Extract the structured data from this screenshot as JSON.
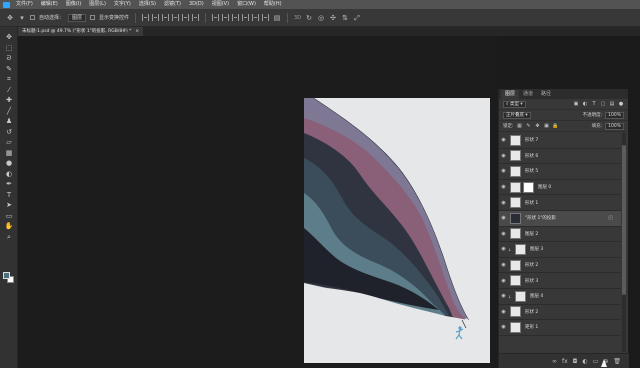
{
  "menubar": {
    "items": [
      "文件(F)",
      "编辑(E)",
      "图像(I)",
      "图层(L)",
      "文字(Y)",
      "选择(S)",
      "滤镜(T)",
      "3D(D)",
      "视图(V)",
      "窗口(W)",
      "帮助(H)"
    ]
  },
  "optionsbar": {
    "auto_select_label": "自动选择：",
    "auto_select_value": "图层",
    "show_transform_label": "显示变换控件"
  },
  "document_tab": {
    "title": "未标题-1.psd @ 49.7% (\"形状 1\"的投影, RGB/8#) *",
    "close": "×"
  },
  "tools": [
    "move-icon",
    "marquee-icon",
    "lasso-icon",
    "quick-select-icon",
    "crop-icon",
    "eyedropper-icon",
    "healing-icon",
    "brush-icon",
    "stamp-icon",
    "history-brush-icon",
    "eraser-icon",
    "gradient-icon",
    "blur-icon",
    "dodge-icon",
    "pen-icon",
    "type-icon",
    "path-select-icon",
    "shape-icon",
    "hand-icon",
    "zoom-icon"
  ],
  "colors": {
    "foreground": "#4e6f7c",
    "background": "#ffffff",
    "accent": "#31a8ff",
    "canvas_bg": "#e6e7e9"
  },
  "layers_panel": {
    "tabs": [
      "图层",
      "通道",
      "路径"
    ],
    "filter_label": "类型",
    "blend_mode": "正片叠底",
    "opacity_label": "不透明度:",
    "opacity_value": "100%",
    "lock_label": "锁定:",
    "fill_label": "填充:",
    "fill_value": "100%",
    "layers": [
      {
        "name": "形状 7",
        "thumb": "light",
        "selected": false,
        "fx": false,
        "indent": false
      },
      {
        "name": "形状 6",
        "thumb": "light",
        "selected": false,
        "fx": false,
        "indent": false
      },
      {
        "name": "形状 5",
        "thumb": "light",
        "selected": false,
        "fx": false,
        "indent": false
      },
      {
        "name": "图层 0",
        "thumb": "light",
        "selected": false,
        "fx": false,
        "indent": false
      },
      {
        "name": "形状 1",
        "thumb": "light",
        "selected": false,
        "fx": false,
        "indent": false
      },
      {
        "name": "\"形状 1\"的投影",
        "thumb": "dark",
        "selected": true,
        "fx": true,
        "indent": false
      },
      {
        "name": "图层 2",
        "thumb": "light",
        "selected": false,
        "fx": false,
        "indent": false
      },
      {
        "name": "图层 3",
        "thumb": "light",
        "selected": false,
        "fx": false,
        "indent": true
      },
      {
        "name": "形状 2",
        "thumb": "light",
        "selected": false,
        "fx": false,
        "indent": false
      },
      {
        "name": "形状 3",
        "thumb": "light",
        "selected": false,
        "fx": false,
        "indent": false
      },
      {
        "name": "图层 4",
        "thumb": "light",
        "selected": false,
        "fx": false,
        "indent": true
      },
      {
        "name": "形状 2",
        "thumb": "light",
        "selected": false,
        "fx": false,
        "indent": false
      },
      {
        "name": "矩形 1",
        "thumb": "light",
        "selected": false,
        "fx": false,
        "indent": false
      }
    ],
    "footer_icons": [
      "link-icon",
      "fx-icon",
      "mask-icon",
      "adjustment-icon",
      "folder-icon",
      "new-layer-icon",
      "trash-icon"
    ],
    "footer_glyphs": [
      "∞",
      "fx",
      "◘",
      "◐",
      "▭",
      "⊕",
      "🗑"
    ]
  }
}
